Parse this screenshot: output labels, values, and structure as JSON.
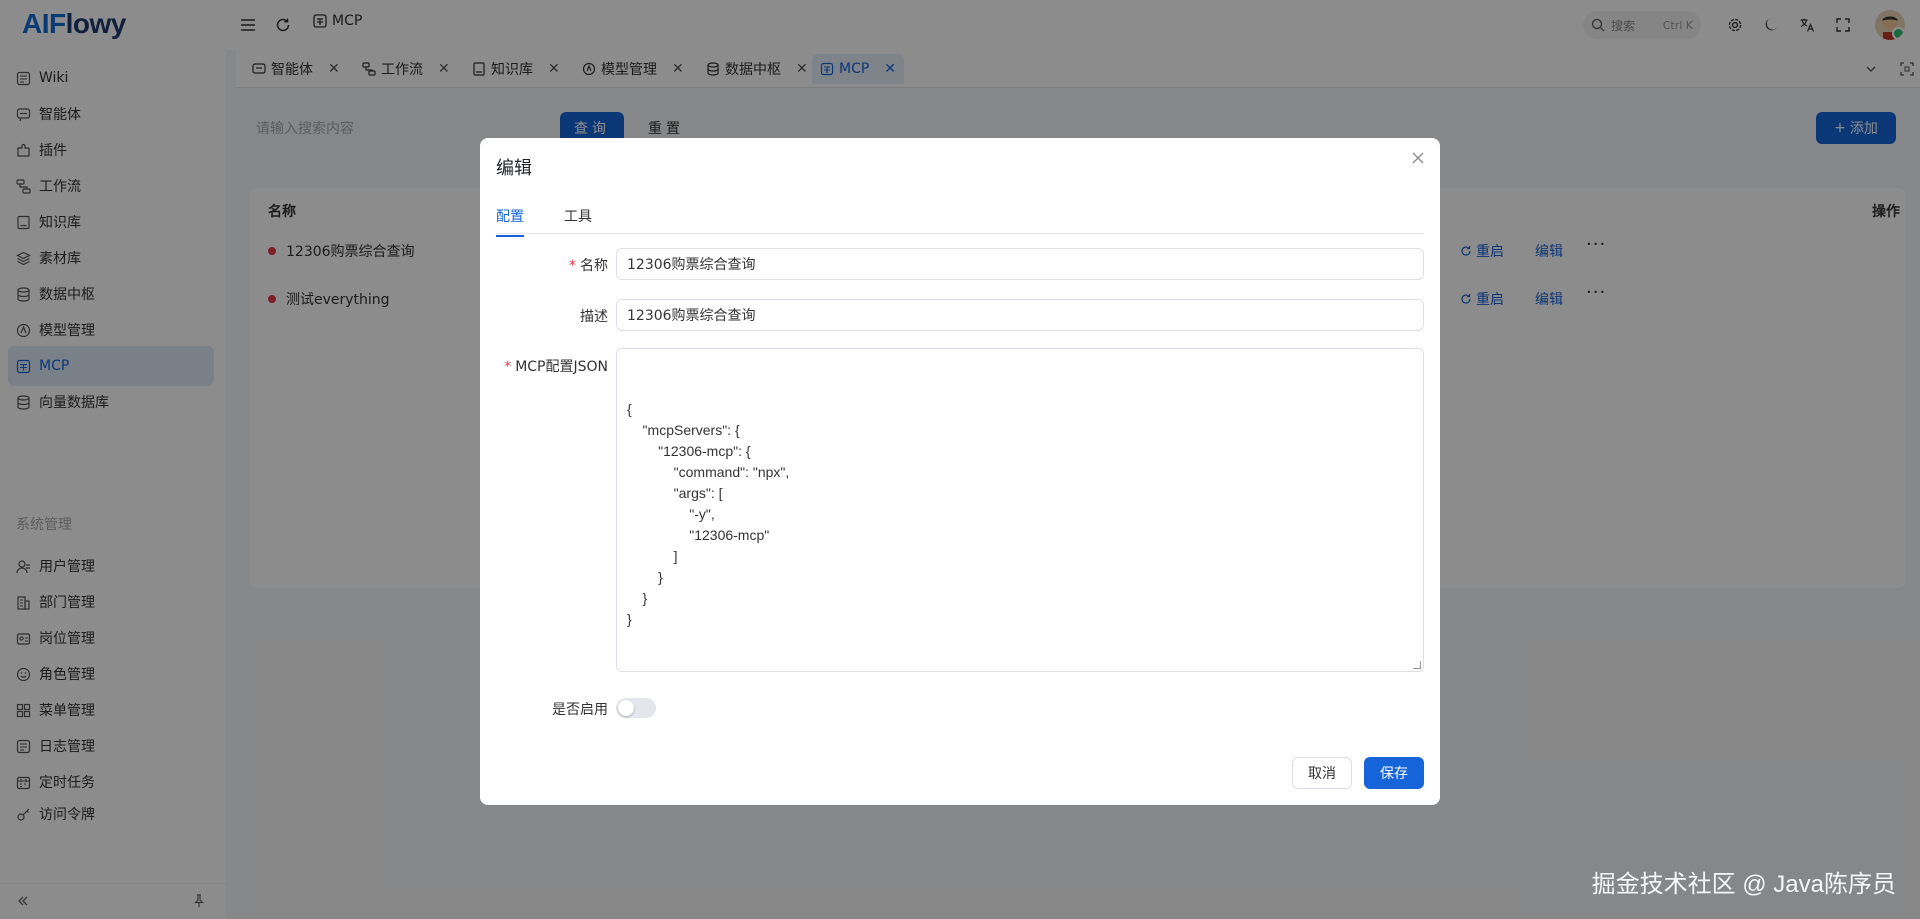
{
  "app": {
    "logo_main": "AIF",
    "logo_rest": "lowy"
  },
  "topbar": {
    "breadcrumb": "MCP",
    "search_label": "搜索",
    "search_shortcut": "Ctrl K"
  },
  "tabs": [
    {
      "label": "智能体",
      "icon": "agent-icon"
    },
    {
      "label": "工作流",
      "icon": "workflow-icon"
    },
    {
      "label": "知识库",
      "icon": "book-icon"
    },
    {
      "label": "模型管理",
      "icon": "model-icon"
    },
    {
      "label": "数据中枢",
      "icon": "database-icon"
    },
    {
      "label": "MCP",
      "icon": "mcp-icon",
      "active": true
    }
  ],
  "sidebar": {
    "items": [
      {
        "label": "Wiki"
      },
      {
        "label": "智能体"
      },
      {
        "label": "插件"
      },
      {
        "label": "工作流"
      },
      {
        "label": "知识库"
      },
      {
        "label": "素材库"
      },
      {
        "label": "数据中枢"
      },
      {
        "label": "模型管理"
      },
      {
        "label": "MCP",
        "active": true
      },
      {
        "label": "向量数据库"
      }
    ],
    "section_title": "系统管理",
    "system_items": [
      {
        "label": "用户管理"
      },
      {
        "label": "部门管理"
      },
      {
        "label": "岗位管理"
      },
      {
        "label": "角色管理"
      },
      {
        "label": "菜单管理"
      },
      {
        "label": "日志管理"
      },
      {
        "label": "定时任务"
      },
      {
        "label": "访问令牌"
      }
    ]
  },
  "main": {
    "search_placeholder": "请输入搜索内容",
    "query_button": "查询",
    "reset_button": "重置",
    "add_button": "添加",
    "table": {
      "col_name": "名称",
      "col_actions": "操作",
      "rows": [
        {
          "name": "12306购票综合查询",
          "restart": "重启",
          "edit": "编辑"
        },
        {
          "name": "测试everything",
          "restart": "重启",
          "edit": "编辑"
        }
      ]
    }
  },
  "modal": {
    "title": "编辑",
    "tabs": [
      "配置",
      "工具"
    ],
    "fields": {
      "name_label": "名称",
      "name_value": "12306购票综合查询",
      "desc_label": "描述",
      "desc_value": "12306购票综合查询",
      "json_label": "MCP配置JSON",
      "json_value": "{\n    \"mcpServers\": {\n        \"12306-mcp\": {\n            \"command\": \"npx\",\n            \"args\": [\n                \"-y\",\n                \"12306-mcp\"\n            ]\n        }\n    }\n}",
      "enabled_label": "是否启用",
      "enabled": false
    },
    "cancel_button": "取消",
    "save_button": "保存"
  },
  "watermark": "掘金技术社区 @ Java陈序员",
  "colors": {
    "accent": "#1664d9",
    "danger_dot": "#e0394c",
    "active_bg": "#dfe9f8"
  }
}
